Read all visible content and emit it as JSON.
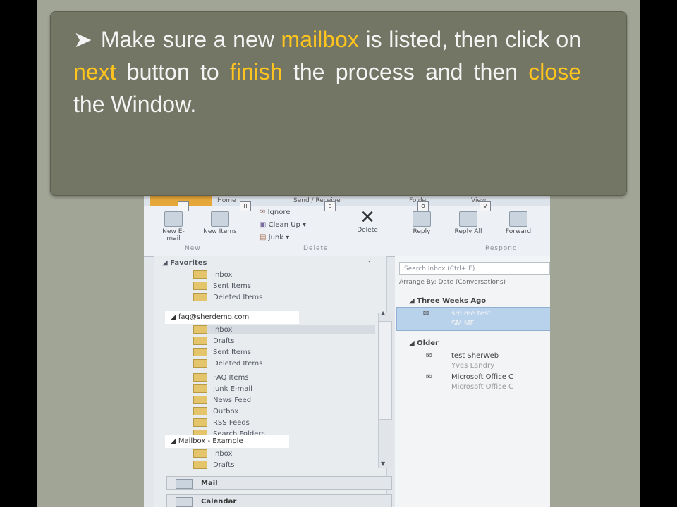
{
  "callout": {
    "bullet": "➤",
    "segments": [
      "Make sure a new ",
      "mailbox",
      " is listed, then click on ",
      "next",
      " button to ",
      "finish",
      " the process and then ",
      "close",
      " the Window."
    ]
  },
  "ribbon": {
    "tabs": [
      "Home",
      "Send / Receive",
      "Folder",
      "View"
    ],
    "keytips": [
      "H",
      "S",
      "O",
      "V"
    ],
    "new_email": "New E-mail",
    "new_items": "New Items",
    "group_new": "New",
    "ignore": "Ignore",
    "clean_up": "Clean Up",
    "junk": "Junk",
    "delete": "Delete",
    "group_delete": "Delete",
    "reply": "Reply",
    "reply_all": "Reply All",
    "forward": "Forward",
    "group_respond": "Respond"
  },
  "nav": {
    "favorites": "Favorites",
    "fav_items": [
      "Inbox",
      "Sent Items",
      "Deleted Items"
    ],
    "account1": "faq@sherdemo.com",
    "account1_items": [
      "Inbox",
      "Drafts",
      "Sent Items",
      "Deleted Items",
      "FAQ Items",
      "Junk E-mail",
      "News Feed",
      "Outbox",
      "RSS Feeds",
      "Search Folders"
    ],
    "account2": "Mailbox - Example",
    "account2_items": [
      "Inbox",
      "Drafts"
    ],
    "mail_button": "Mail",
    "calendar_button": "Calendar"
  },
  "messages": {
    "search_placeholder": "Search Inbox (Ctrl+ E)",
    "arrange": "Arrange By: Date (Conversations)",
    "group1": "Three Weeks Ago",
    "item1_subject": "smime test",
    "item1_from": "SMIMF",
    "group2": "Older",
    "item2_subject": "test SherWeb",
    "item2_from": "Yves Landry",
    "item3_subject": "Microsoft Office C",
    "item3_from": "Microsoft Office C"
  },
  "colors": {
    "slide_bg": "#a1a596",
    "callout_bg": "#737664",
    "highlight": "#ffc51e",
    "text": "#f4f4f4"
  }
}
